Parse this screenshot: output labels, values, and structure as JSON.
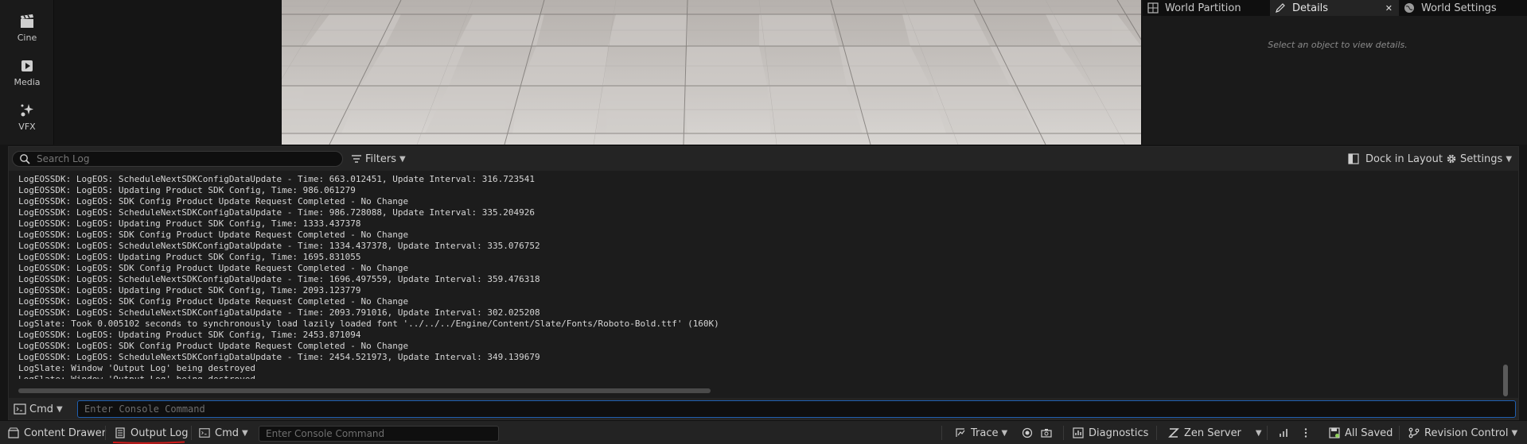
{
  "left_toolbar": {
    "items": [
      {
        "label": "Cine",
        "icon": "clapperboard-icon"
      },
      {
        "label": "Media",
        "icon": "media-icon"
      },
      {
        "label": "VFX",
        "icon": "sparkle-icon"
      }
    ]
  },
  "details_panel": {
    "tabs": [
      {
        "label": "World Partition",
        "icon": "world-partition-icon"
      },
      {
        "label": "Details",
        "icon": "pencil-icon",
        "close": "✕"
      },
      {
        "label": "World Settings",
        "icon": "globe-icon"
      }
    ],
    "hint": "Select an object to view details."
  },
  "log_toolbar": {
    "search_placeholder": "Search Log",
    "filters_label": "Filters",
    "dock_label": "Dock in Layout",
    "settings_label": "Settings"
  },
  "log_lines": [
    "LogEOSSDK: LogEOS: ScheduleNextSDKConfigDataUpdate - Time: 663.012451, Update Interval: 316.723541",
    "LogEOSSDK: LogEOS: Updating Product SDK Config, Time: 986.061279",
    "LogEOSSDK: LogEOS: SDK Config Product Update Request Completed - No Change",
    "LogEOSSDK: LogEOS: ScheduleNextSDKConfigDataUpdate - Time: 986.728088, Update Interval: 335.204926",
    "LogEOSSDK: LogEOS: Updating Product SDK Config, Time: 1333.437378",
    "LogEOSSDK: LogEOS: SDK Config Product Update Request Completed - No Change",
    "LogEOSSDK: LogEOS: ScheduleNextSDKConfigDataUpdate - Time: 1334.437378, Update Interval: 335.076752",
    "LogEOSSDK: LogEOS: Updating Product SDK Config, Time: 1695.831055",
    "LogEOSSDK: LogEOS: SDK Config Product Update Request Completed - No Change",
    "LogEOSSDK: LogEOS: ScheduleNextSDKConfigDataUpdate - Time: 1696.497559, Update Interval: 359.476318",
    "LogEOSSDK: LogEOS: Updating Product SDK Config, Time: 2093.123779",
    "LogEOSSDK: LogEOS: SDK Config Product Update Request Completed - No Change",
    "LogEOSSDK: LogEOS: ScheduleNextSDKConfigDataUpdate - Time: 2093.791016, Update Interval: 302.025208",
    "LogSlate: Took 0.005102 seconds to synchronously load lazily loaded font '../../../Engine/Content/Slate/Fonts/Roboto-Bold.ttf' (160K)",
    "LogEOSSDK: LogEOS: Updating Product SDK Config, Time: 2453.871094",
    "LogEOSSDK: LogEOS: SDK Config Product Update Request Completed - No Change",
    "LogEOSSDK: LogEOS: ScheduleNextSDKConfigDataUpdate - Time: 2454.521973, Update Interval: 349.139679",
    "LogSlate: Window 'Output Log' being destroyed",
    "LogSlate: Window 'Output Log' being destroyed"
  ],
  "command_row": {
    "cmd_label": "Cmd",
    "console_placeholder": "Enter Console Command"
  },
  "status_bar": {
    "content_drawer": "Content Drawer",
    "output_log": "Output Log",
    "cmd_label": "Cmd",
    "console_placeholder": "Enter Console Command",
    "trace": "Trace",
    "diagnostics": "Diagnostics",
    "zen_server": "Zen Server",
    "all_saved": "All Saved",
    "revision_control": "Revision Control"
  },
  "colors": {
    "accent_blue": "#1f5fb0",
    "underline_red": "#d11a1a",
    "saved_green": "#8fcf5a"
  }
}
